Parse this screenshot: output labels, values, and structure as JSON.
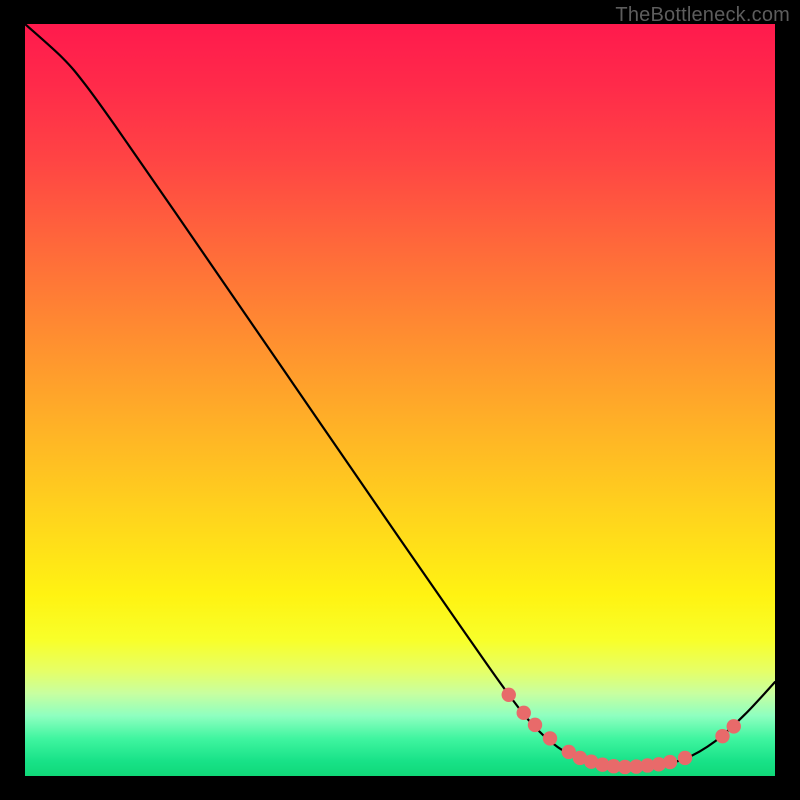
{
  "watermark": "TheBottleneck.com",
  "chart_data": {
    "type": "line",
    "title": "",
    "xlabel": "",
    "ylabel": "",
    "xlim": [
      0,
      100
    ],
    "ylim": [
      0,
      100
    ],
    "grid": false,
    "legend": false,
    "curve": [
      {
        "x": 0,
        "y": 100
      },
      {
        "x": 5,
        "y": 95.5
      },
      {
        "x": 8,
        "y": 92
      },
      {
        "x": 12,
        "y": 86.5
      },
      {
        "x": 20,
        "y": 75
      },
      {
        "x": 30,
        "y": 60.5
      },
      {
        "x": 40,
        "y": 46
      },
      {
        "x": 50,
        "y": 31.5
      },
      {
        "x": 58,
        "y": 20
      },
      {
        "x": 64,
        "y": 11.5
      },
      {
        "x": 68,
        "y": 6.5
      },
      {
        "x": 72,
        "y": 3.2
      },
      {
        "x": 76,
        "y": 1.6
      },
      {
        "x": 80,
        "y": 1.2
      },
      {
        "x": 84,
        "y": 1.4
      },
      {
        "x": 88,
        "y": 2.3
      },
      {
        "x": 92,
        "y": 4.6
      },
      {
        "x": 96,
        "y": 8.2
      },
      {
        "x": 100,
        "y": 12.5
      }
    ],
    "highlight_points": [
      {
        "x": 64.5,
        "y": 10.8
      },
      {
        "x": 66.5,
        "y": 8.4
      },
      {
        "x": 68.0,
        "y": 6.8
      },
      {
        "x": 70.0,
        "y": 5.0
      },
      {
        "x": 72.5,
        "y": 3.2
      },
      {
        "x": 74.0,
        "y": 2.4
      },
      {
        "x": 75.5,
        "y": 1.9
      },
      {
        "x": 77.0,
        "y": 1.5
      },
      {
        "x": 78.5,
        "y": 1.3
      },
      {
        "x": 80.0,
        "y": 1.2
      },
      {
        "x": 81.5,
        "y": 1.25
      },
      {
        "x": 83.0,
        "y": 1.4
      },
      {
        "x": 84.5,
        "y": 1.55
      },
      {
        "x": 86.0,
        "y": 1.85
      },
      {
        "x": 88.0,
        "y": 2.4
      },
      {
        "x": 93.0,
        "y": 5.3
      },
      {
        "x": 94.5,
        "y": 6.6
      }
    ],
    "dot_radius_px": 7.2
  }
}
